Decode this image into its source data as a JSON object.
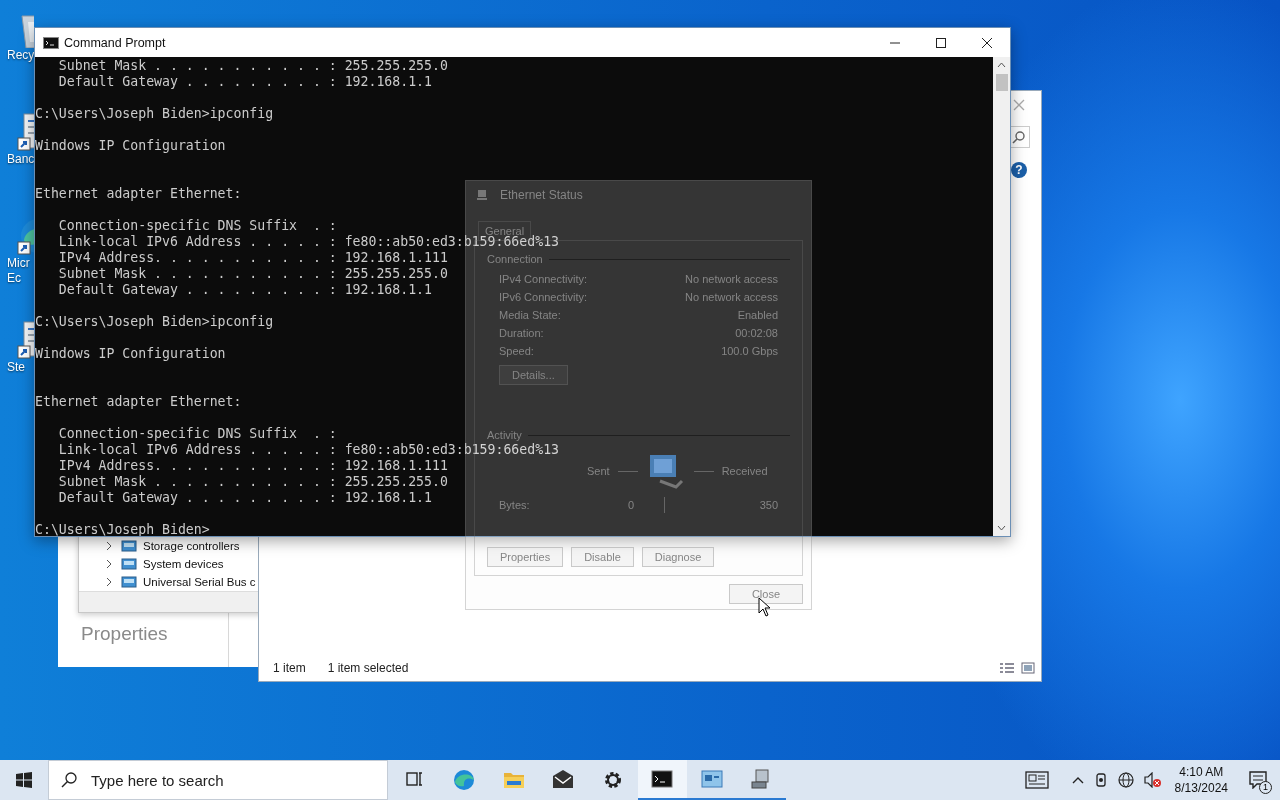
{
  "desktop_icons": [
    {
      "kind": "recycle-bin",
      "label_lines": [
        "Recy"
      ]
    },
    {
      "kind": "shortcut",
      "label_lines": [
        "Banc"
      ]
    },
    {
      "kind": "browser",
      "label_lines": [
        "Micr",
        "Ec"
      ]
    },
    {
      "kind": "shortcut",
      "label_lines": [
        "Ste"
      ]
    }
  ],
  "device_window": {
    "tree": [
      {
        "label": "Storage controllers",
        "expanded": false
      },
      {
        "label": "System devices",
        "expanded": false
      },
      {
        "label": "Universal Serial Bus c",
        "expanded": false
      }
    ]
  },
  "properties_window": {
    "title": "Properties"
  },
  "explorer_window": {
    "help": "?",
    "status_bar": {
      "item_count": "1 item",
      "selection": "1 item selected"
    }
  },
  "status_dialog": {
    "title": "Ethernet Status",
    "tab": "General",
    "connection": {
      "heading": "Connection",
      "rows": [
        {
          "label": "IPv4 Connectivity:",
          "value": "No network access"
        },
        {
          "label": "IPv6 Connectivity:",
          "value": "No network access"
        },
        {
          "label": "Media State:",
          "value": "Enabled"
        },
        {
          "label": "Duration:",
          "value": "00:02:08"
        },
        {
          "label": "Speed:",
          "value": "100.0 Gbps"
        }
      ],
      "details_button": "Details..."
    },
    "activity": {
      "heading": "Activity",
      "sent": "Sent",
      "received": "Received",
      "bytes_label": "Bytes:",
      "bytes_sent": "0",
      "bytes_received": "350"
    },
    "buttons": [
      "Properties",
      "Disable",
      "Diagnose"
    ],
    "close_button": "Close"
  },
  "command_prompt": {
    "title": "Command Prompt",
    "lines": [
      {
        "kind": "text",
        "text": "   Subnet Mask . . . . . . . . . . . : 255.255.255.0"
      },
      {
        "kind": "text",
        "text": "   Default Gateway . . . . . . . . . : 192.168.1.1"
      },
      {
        "kind": "blank"
      },
      {
        "kind": "text",
        "text": "C:\\Users\\Joseph Biden>ipconfig"
      },
      {
        "kind": "blank"
      },
      {
        "kind": "text",
        "text": "Windows IP Configuration"
      },
      {
        "kind": "blank"
      },
      {
        "kind": "blank"
      },
      {
        "kind": "text",
        "text": "Ethernet adapter Ethernet:"
      },
      {
        "kind": "blank"
      },
      {
        "kind": "text",
        "text": "   Connection-specific DNS Suffix  . :"
      },
      {
        "kind": "text",
        "text": "   Link-local IPv6 Address . . . . . : fe80::ab50:ed3:b159:66ed%13"
      },
      {
        "kind": "text",
        "text": "   IPv4 Address. . . . . . . . . . . : 192.168.1.111"
      },
      {
        "kind": "text",
        "text": "   Subnet Mask . . . . . . . . . . . : 255.255.255.0"
      },
      {
        "kind": "text",
        "text": "   Default Gateway . . . . . . . . . : 192.168.1.1"
      },
      {
        "kind": "blank"
      },
      {
        "kind": "text",
        "text": "C:\\Users\\Joseph Biden>ipconfig"
      },
      {
        "kind": "blank"
      },
      {
        "kind": "text",
        "text": "Windows IP Configuration"
      },
      {
        "kind": "blank"
      },
      {
        "kind": "blank"
      },
      {
        "kind": "text",
        "text": "Ethernet adapter Ethernet:"
      },
      {
        "kind": "blank"
      },
      {
        "kind": "text",
        "text": "   Connection-specific DNS Suffix  . :"
      },
      {
        "kind": "text",
        "text": "   Link-local IPv6 Address . . . . . : fe80::ab50:ed3:b159:66ed%13"
      },
      {
        "kind": "text",
        "text": "   IPv4 Address. . . . . . . . . . . : 192.168.1.111"
      },
      {
        "kind": "text",
        "text": "   Subnet Mask . . . . . . . . . . . : 255.255.255.0"
      },
      {
        "kind": "text",
        "text": "   Default Gateway . . . . . . . . . : 192.168.1.1"
      },
      {
        "kind": "blank"
      },
      {
        "kind": "text",
        "text": "C:\\Users\\Joseph Biden>"
      }
    ]
  },
  "taskbar": {
    "search": {
      "placeholder": "Type here to search"
    },
    "apps": [
      {
        "kind": "task-view",
        "running": false,
        "selected": false
      },
      {
        "kind": "browser",
        "running": false,
        "selected": false
      },
      {
        "kind": "folder",
        "running": false,
        "selected": false
      },
      {
        "kind": "mail",
        "running": false,
        "selected": false
      },
      {
        "kind": "settings",
        "running": false,
        "selected": false
      },
      {
        "kind": "terminal",
        "running": true,
        "selected": true
      },
      {
        "kind": "network",
        "running": true,
        "selected": false
      },
      {
        "kind": "device",
        "running": true,
        "selected": false
      }
    ],
    "time": "4:10 AM",
    "date": "8/13/2024",
    "notification_count": "1"
  }
}
